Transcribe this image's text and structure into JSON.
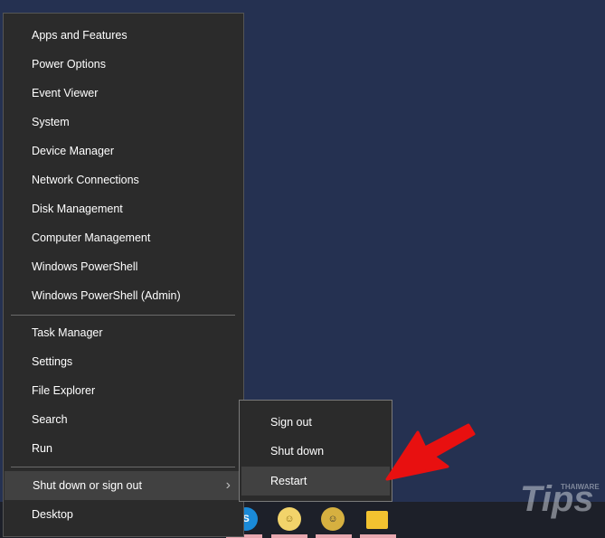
{
  "menu": {
    "group1": [
      "Apps and Features",
      "Power Options",
      "Event Viewer",
      "System",
      "Device Manager",
      "Network Connections",
      "Disk Management",
      "Computer Management",
      "Windows PowerShell",
      "Windows PowerShell (Admin)"
    ],
    "group2": [
      "Task Manager",
      "Settings",
      "File Explorer",
      "Search",
      "Run"
    ],
    "shutdown": "Shut down or sign out",
    "desktop": "Desktop"
  },
  "submenu": [
    "Sign out",
    "Shut down",
    "Restart"
  ],
  "watermark": {
    "brand": "Tips",
    "small": "THAIWARE"
  },
  "colors": {
    "arrow": "#e81010",
    "desktop": "#253151",
    "menu": "#2b2b2b"
  }
}
